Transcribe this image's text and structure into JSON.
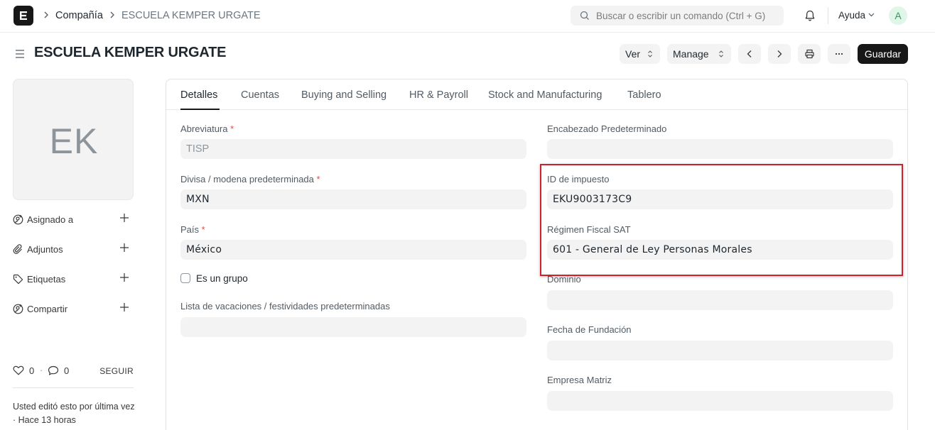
{
  "navbar": {
    "breadcrumbs": [
      "Compañía",
      "ESCUELA KEMPER URGATE"
    ],
    "search_placeholder": "Buscar o escribir un comando (Ctrl + G)",
    "help_label": "Ayuda",
    "avatar_initial": "A"
  },
  "page": {
    "title": "ESCUELA KEMPER URGATE",
    "actions": {
      "view_label": "Ver",
      "manage_label": "Manage",
      "save_label": "Guardar"
    }
  },
  "sidebar": {
    "initials": "EK",
    "items": [
      {
        "label": "Asignado a",
        "icon": "assign-icon"
      },
      {
        "label": "Adjuntos",
        "icon": "attachment-icon"
      },
      {
        "label": "Etiquetas",
        "icon": "tag-icon"
      },
      {
        "label": "Compartir",
        "icon": "share-icon"
      }
    ],
    "likes": "0",
    "comments": "0",
    "follow_label": "SEGUIR",
    "edit_note": "Usted editó esto por última vez · Hace 13 horas"
  },
  "tabs": [
    "Detalles",
    "Cuentas",
    "Buying and Selling",
    "HR & Payroll",
    "Stock and Manufacturing",
    "Tablero"
  ],
  "active_tab": "Detalles",
  "form": {
    "left": {
      "abbr_label": "Abreviatura",
      "abbr_value": "TISP",
      "currency_label": "Divisa / modena predeterminada",
      "currency_value": "MXN",
      "country_label": "País",
      "country_value": "México",
      "is_group_label": "Es un grupo",
      "holiday_label": "Lista de vacaciones / festividades predeterminadas",
      "holiday_value": ""
    },
    "right": {
      "letterhead_label": "Encabezado Predeterminado",
      "letterhead_value": "",
      "tax_id_label": "ID de impuesto",
      "tax_id_value": "EKU9003173C9",
      "regime_label": "Régimen Fiscal SAT",
      "regime_value": "601 - General de Ley Personas Morales",
      "domain_label": "Dominio",
      "domain_value": "",
      "founding_label": "Fecha de Fundación",
      "founding_value": "",
      "parent_label": "Empresa Matriz",
      "parent_value": ""
    },
    "required_marker": "*"
  },
  "colors": {
    "primary_button": "#171717",
    "highlight_border": "#d0202c",
    "field_bg": "#f3f3f3",
    "required": "#e24c4c"
  }
}
